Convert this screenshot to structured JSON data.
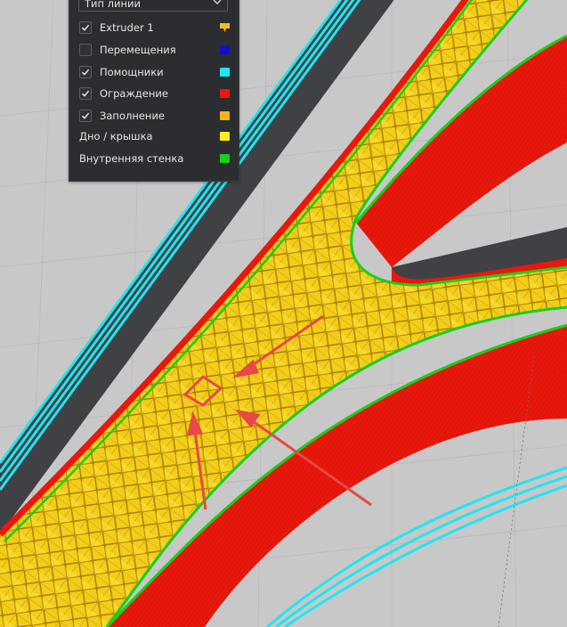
{
  "legend": {
    "dropdown_value": "Тип линии",
    "items": [
      {
        "label": "Extruder 1",
        "checked": true,
        "has_checkbox": true,
        "color": "#f2c01e",
        "swatch": "extruder-shape"
      },
      {
        "label": "Перемещения",
        "checked": false,
        "has_checkbox": true,
        "color": "#1010c8"
      },
      {
        "label": "Помощники",
        "checked": true,
        "has_checkbox": true,
        "color": "#1ee6f2"
      },
      {
        "label": "Ограждение",
        "checked": true,
        "has_checkbox": true,
        "color": "#e8180c"
      },
      {
        "label": "Заполнение",
        "checked": true,
        "has_checkbox": true,
        "color": "#f2b419"
      },
      {
        "label": "Дно / крышка",
        "checked": false,
        "has_checkbox": false,
        "color": "#f7f01c"
      },
      {
        "label": "Внутренняя стенка",
        "checked": false,
        "has_checkbox": false,
        "color": "#16d01a"
      }
    ]
  },
  "colors": {
    "background": "#c9c9c9",
    "grid_line": "#b5b5b5",
    "shell": "#e8180c",
    "infill": "#f7d21c",
    "inner_wall": "#16d01a",
    "helper": "#1ee6f2",
    "travel_dark": "#3f4144",
    "annotation": "#e84848"
  }
}
